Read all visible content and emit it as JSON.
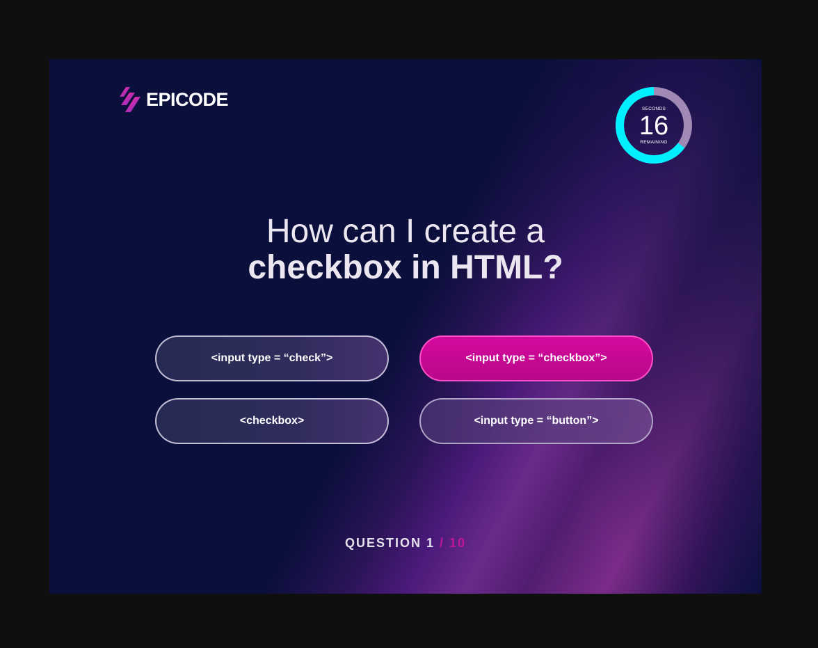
{
  "brand": {
    "name": "EPICODE"
  },
  "timer": {
    "top_label": "SECONDS",
    "value": "16",
    "bottom_label": "REMAINING",
    "elapsed_fraction": 0.35,
    "ring_color": "#00f0ff",
    "track_color": "#a08ab5"
  },
  "question": {
    "line1": "How can I create a",
    "line2": "checkbox in HTML?"
  },
  "answers": [
    {
      "label": "<input type = “check”>",
      "selected": false
    },
    {
      "label": "<input type = “checkbox”>",
      "selected": true
    },
    {
      "label": "<checkbox>",
      "selected": false
    },
    {
      "label": "<input type = “button”>",
      "selected": false
    }
  ],
  "progress": {
    "prefix": "QUESTION 1",
    "separator": "/",
    "total": "10"
  },
  "colors": {
    "accent": "#c0169e",
    "selected_answer": "#d4099e",
    "background": "#0b0f3c"
  }
}
